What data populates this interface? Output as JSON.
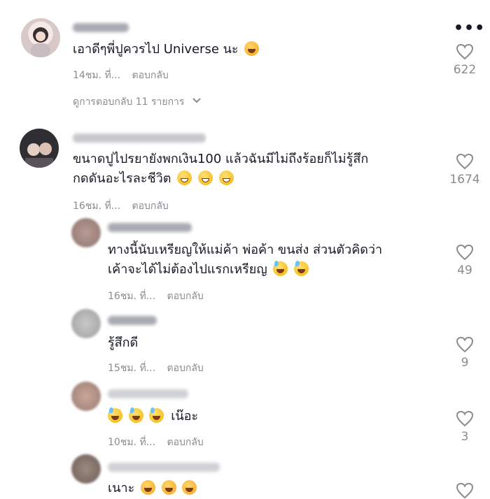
{
  "comments": [
    {
      "text": "เอาดีๆพี่ปูควรไป Universe นะ",
      "emoji": [
        "smile"
      ],
      "time": "14ชม. ที่...",
      "reply": "ตอบกลับ",
      "likes": "622",
      "view_replies": "ดูการตอบกลับ 11 รายการ"
    },
    {
      "text_line1": "ขนาดปูไปรยายังพกเงิน100 แล้วฉันมีไม่ถึงร้อยก็ไม่รู้สึก",
      "text_line2": "กดดันอะไรละชีวิต",
      "emoji": [
        "grin",
        "grin",
        "grin"
      ],
      "time": "16ชม. ที่...",
      "reply": "ตอบกลับ",
      "likes": "1674"
    }
  ],
  "replies": [
    {
      "text_line1": "ทางนี้นับเหรียญให้แม่ค้า พ่อค้า ขนส่ง ส่วนตัวคิดว่า",
      "text_line2": "เค้าจะได้ไม่ต้องไปแรกเหรียญ",
      "emoji": [
        "sweat",
        "sweat"
      ],
      "time": "16ชม. ที่...",
      "reply": "ตอบกลับ",
      "likes": "49"
    },
    {
      "text": "รู้สึกดี",
      "time": "15ชม. ที่...",
      "reply": "ตอบกลับ",
      "likes": "9"
    },
    {
      "text": "เน๊อะ",
      "emoji": [
        "sweat",
        "sweat",
        "sweat"
      ],
      "time": "10ชม. ที่...",
      "reply": "ตอบกลับ",
      "likes": "3"
    },
    {
      "text": "เนาะ",
      "emoji": [
        "smile",
        "smile",
        "smile"
      ]
    }
  ],
  "icons": {
    "more": "more-options-icon",
    "like": "heart-outline-icon",
    "expand": "chevron-down-icon"
  },
  "more_label": "•••"
}
